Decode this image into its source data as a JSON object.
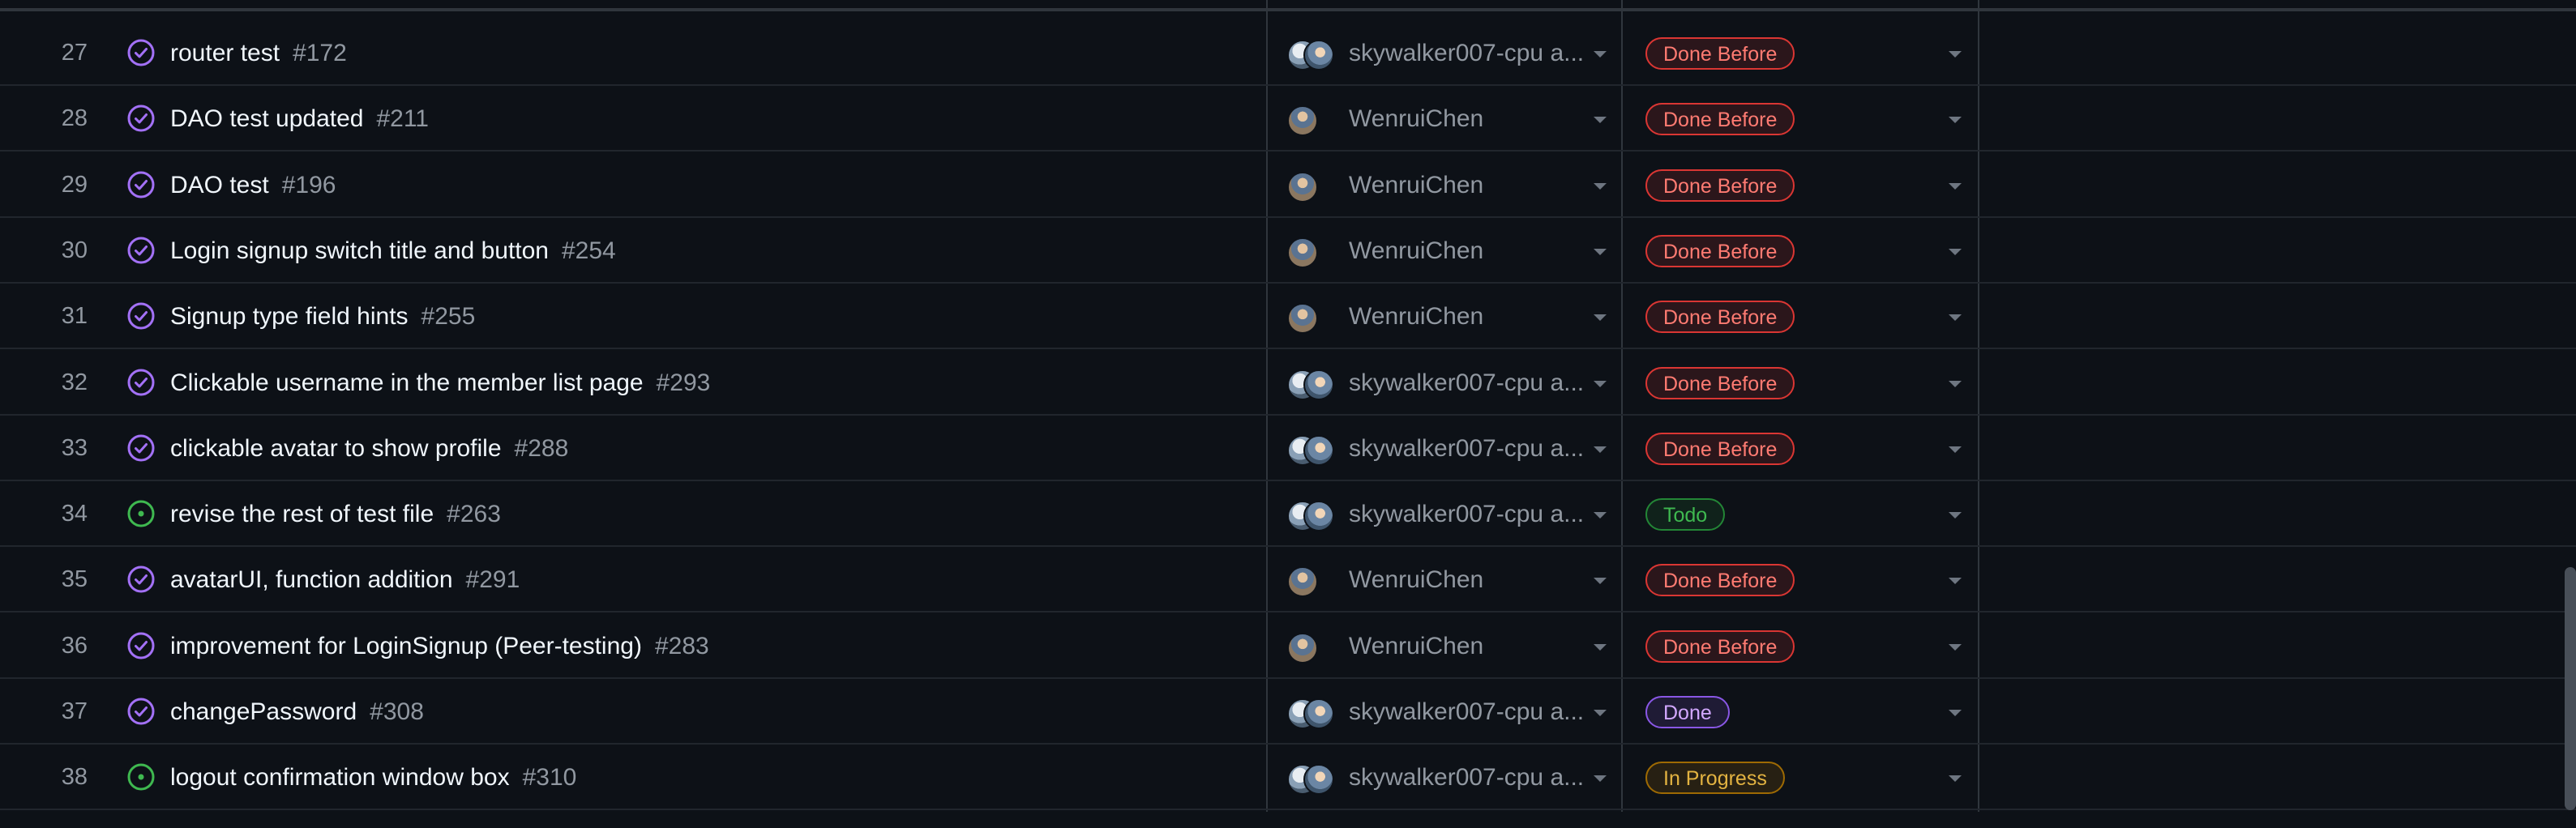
{
  "colors": {
    "background": "#0d1117",
    "border": "#30363d",
    "closed_icon": "#a371f7",
    "open_icon": "#3fb950"
  },
  "rows": [
    {
      "num": "27",
      "state": "closed",
      "title": "router test",
      "issue": "#172",
      "assignee": "skywalker007-cpu a...",
      "avatars": 2,
      "status": "Done Before",
      "status_class": "done-before"
    },
    {
      "num": "28",
      "state": "closed",
      "title": "DAO test updated",
      "issue": "#211",
      "assignee": "WenruiChen",
      "avatars": 1,
      "status": "Done Before",
      "status_class": "done-before"
    },
    {
      "num": "29",
      "state": "closed",
      "title": "DAO test",
      "issue": "#196",
      "assignee": "WenruiChen",
      "avatars": 1,
      "status": "Done Before",
      "status_class": "done-before"
    },
    {
      "num": "30",
      "state": "closed",
      "title": "Login signup switch title and button",
      "issue": "#254",
      "assignee": "WenruiChen",
      "avatars": 1,
      "status": "Done Before",
      "status_class": "done-before"
    },
    {
      "num": "31",
      "state": "closed",
      "title": "Signup type field hints",
      "issue": "#255",
      "assignee": "WenruiChen",
      "avatars": 1,
      "status": "Done Before",
      "status_class": "done-before"
    },
    {
      "num": "32",
      "state": "closed",
      "title": "Clickable username in the member list page",
      "issue": "#293",
      "assignee": "skywalker007-cpu a...",
      "avatars": 2,
      "status": "Done Before",
      "status_class": "done-before"
    },
    {
      "num": "33",
      "state": "closed",
      "title": "clickable avatar to show profile",
      "issue": "#288",
      "assignee": "skywalker007-cpu a...",
      "avatars": 2,
      "status": "Done Before",
      "status_class": "done-before"
    },
    {
      "num": "34",
      "state": "open",
      "title": "revise the rest of test file",
      "issue": "#263",
      "assignee": "skywalker007-cpu a...",
      "avatars": 2,
      "status": "Todo",
      "status_class": "todo"
    },
    {
      "num": "35",
      "state": "closed",
      "title": "avatarUI, function addition",
      "issue": "#291",
      "assignee": "WenruiChen",
      "avatars": 1,
      "status": "Done Before",
      "status_class": "done-before"
    },
    {
      "num": "36",
      "state": "closed",
      "title": "improvement for LoginSignup (Peer-testing)",
      "issue": "#283",
      "assignee": "WenruiChen",
      "avatars": 1,
      "status": "Done Before",
      "status_class": "done-before"
    },
    {
      "num": "37",
      "state": "closed",
      "title": "changePassword",
      "issue": "#308",
      "assignee": "skywalker007-cpu a...",
      "avatars": 2,
      "status": "Done",
      "status_class": "done"
    },
    {
      "num": "38",
      "state": "open",
      "title": "logout confirmation window box",
      "issue": "#310",
      "assignee": "skywalker007-cpu a...",
      "avatars": 2,
      "status": "In Progress",
      "status_class": "in-progress"
    }
  ]
}
